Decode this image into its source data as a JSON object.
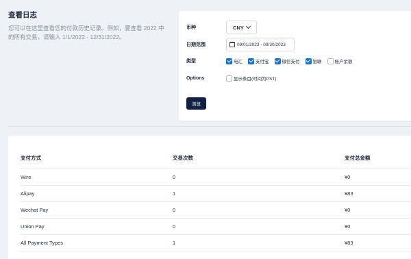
{
  "page": {
    "title": "查看日志",
    "description": "您可以在这里查看您的付款历史记录。例如，要查看 2022 中的所有交易，请输入 1/1/2022 - 12/31/2022。"
  },
  "filters": {
    "currency_label": "币种",
    "currency_value": "CNY",
    "date_label": "日期范围",
    "date_value": "09/01/2023 - 09/30/2023",
    "type_label": "类型",
    "types": [
      {
        "label": "电汇",
        "checked": true
      },
      {
        "label": "支付宝",
        "checked": true
      },
      {
        "label": "微信支付",
        "checked": true
      },
      {
        "label": "银联",
        "checked": true
      },
      {
        "label": "帐户余额",
        "checked": false
      }
    ],
    "options_label": "Options",
    "options_item": {
      "label": "显示条目(时间为PST)",
      "checked": false
    },
    "browse_label": "浏览"
  },
  "table": {
    "headers": [
      "支付方式",
      "交易次数",
      "支付总金额"
    ],
    "rows": [
      [
        "Wire",
        "0",
        "¥0"
      ],
      [
        "Alipay",
        "1",
        "¥83"
      ],
      [
        "Wechat Pay",
        "0",
        "¥0"
      ],
      [
        "Union Pay",
        "0",
        "¥0"
      ],
      [
        "All Payment Types",
        "1",
        "¥83"
      ]
    ]
  },
  "colors": {
    "accent": "#1a73c8",
    "button": "#122042",
    "background": "#eef1f5"
  }
}
